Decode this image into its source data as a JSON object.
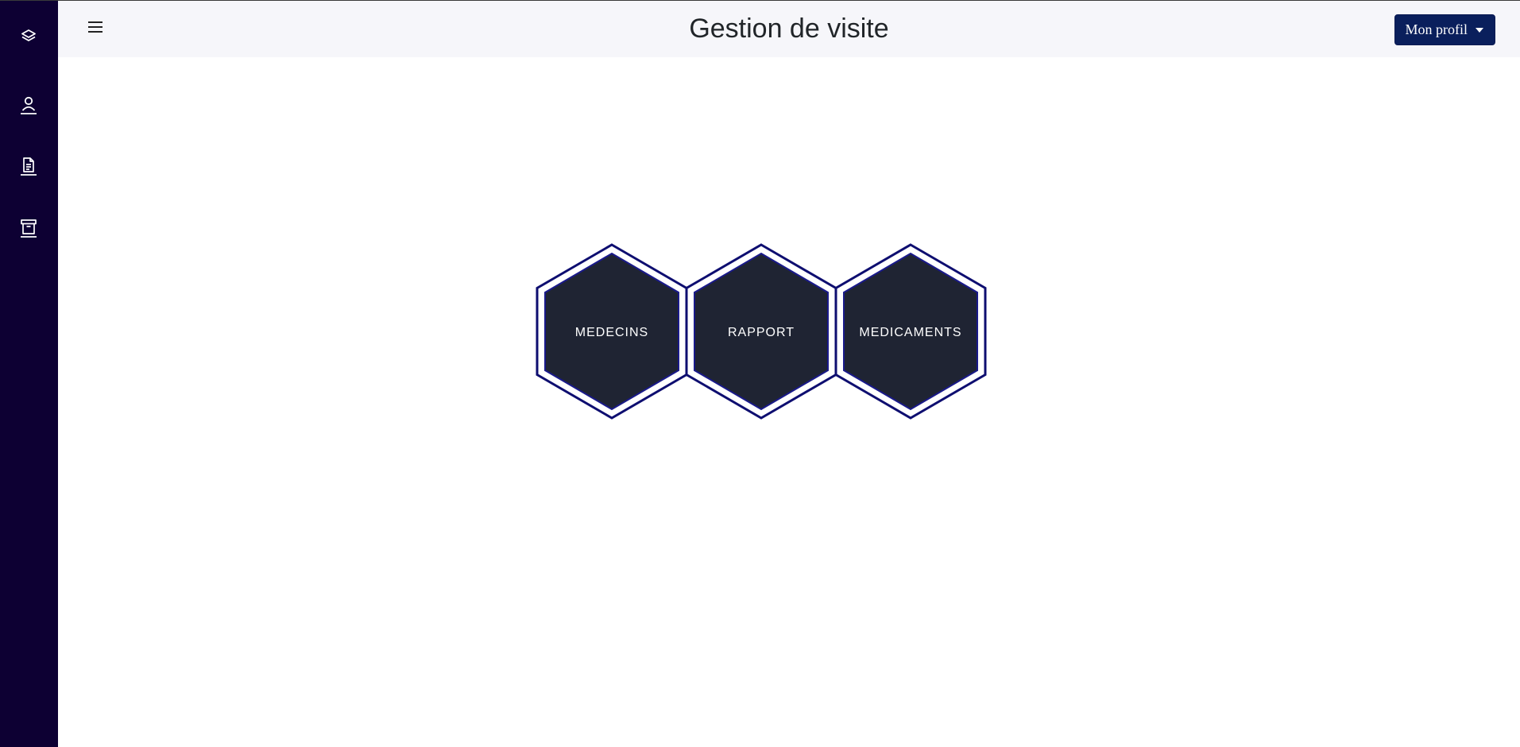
{
  "header": {
    "title": "Gestion de visite",
    "profile_button": "Mon profil"
  },
  "sidebar": {
    "items": [
      {
        "icon": "layers-icon"
      },
      {
        "icon": "user-icon"
      },
      {
        "icon": "document-icon"
      },
      {
        "icon": "archive-icon"
      }
    ]
  },
  "tiles": [
    {
      "label": "MEDECINS"
    },
    {
      "label": "RAPPORT"
    },
    {
      "label": "MEDICAMENTS"
    }
  ],
  "colors": {
    "sidebar_bg": "#0d0033",
    "topbar_bg": "#f6f6fa",
    "button_bg": "#0a1f5c",
    "hex_outline": "#0e0e70",
    "hex_fill": "#1f2433"
  }
}
